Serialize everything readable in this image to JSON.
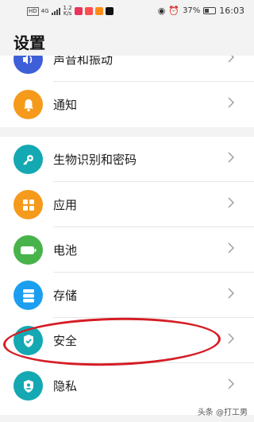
{
  "status_bar": {
    "sim_label": "HD",
    "network_label": "4G",
    "speed_value": "1.2",
    "speed_unit": "K/s",
    "battery_percent": "37%",
    "time": "16:03"
  },
  "page": {
    "title": "设置"
  },
  "section1": {
    "items": [
      {
        "label": "声音和振动",
        "icon": "speaker-icon",
        "color": "#3e5fd8"
      },
      {
        "label": "通知",
        "icon": "bell-icon",
        "color": "#f59a1b"
      }
    ]
  },
  "section2": {
    "items": [
      {
        "label": "生物识别和密码",
        "icon": "key-icon",
        "color": "#14a8b3"
      },
      {
        "label": "应用",
        "icon": "apps-grid-icon",
        "color": "#f59a1b"
      },
      {
        "label": "电池",
        "icon": "battery-icon",
        "color": "#48b34a"
      },
      {
        "label": "存储",
        "icon": "storage-icon",
        "color": "#1b9ef0"
      },
      {
        "label": "安全",
        "icon": "shield-icon",
        "color": "#14a8b3"
      },
      {
        "label": "隐私",
        "icon": "privacy-icon",
        "color": "#14a8b3"
      }
    ]
  },
  "annotation": {
    "highlight_color": "#d51d25"
  },
  "watermark": "头条 @打工男"
}
